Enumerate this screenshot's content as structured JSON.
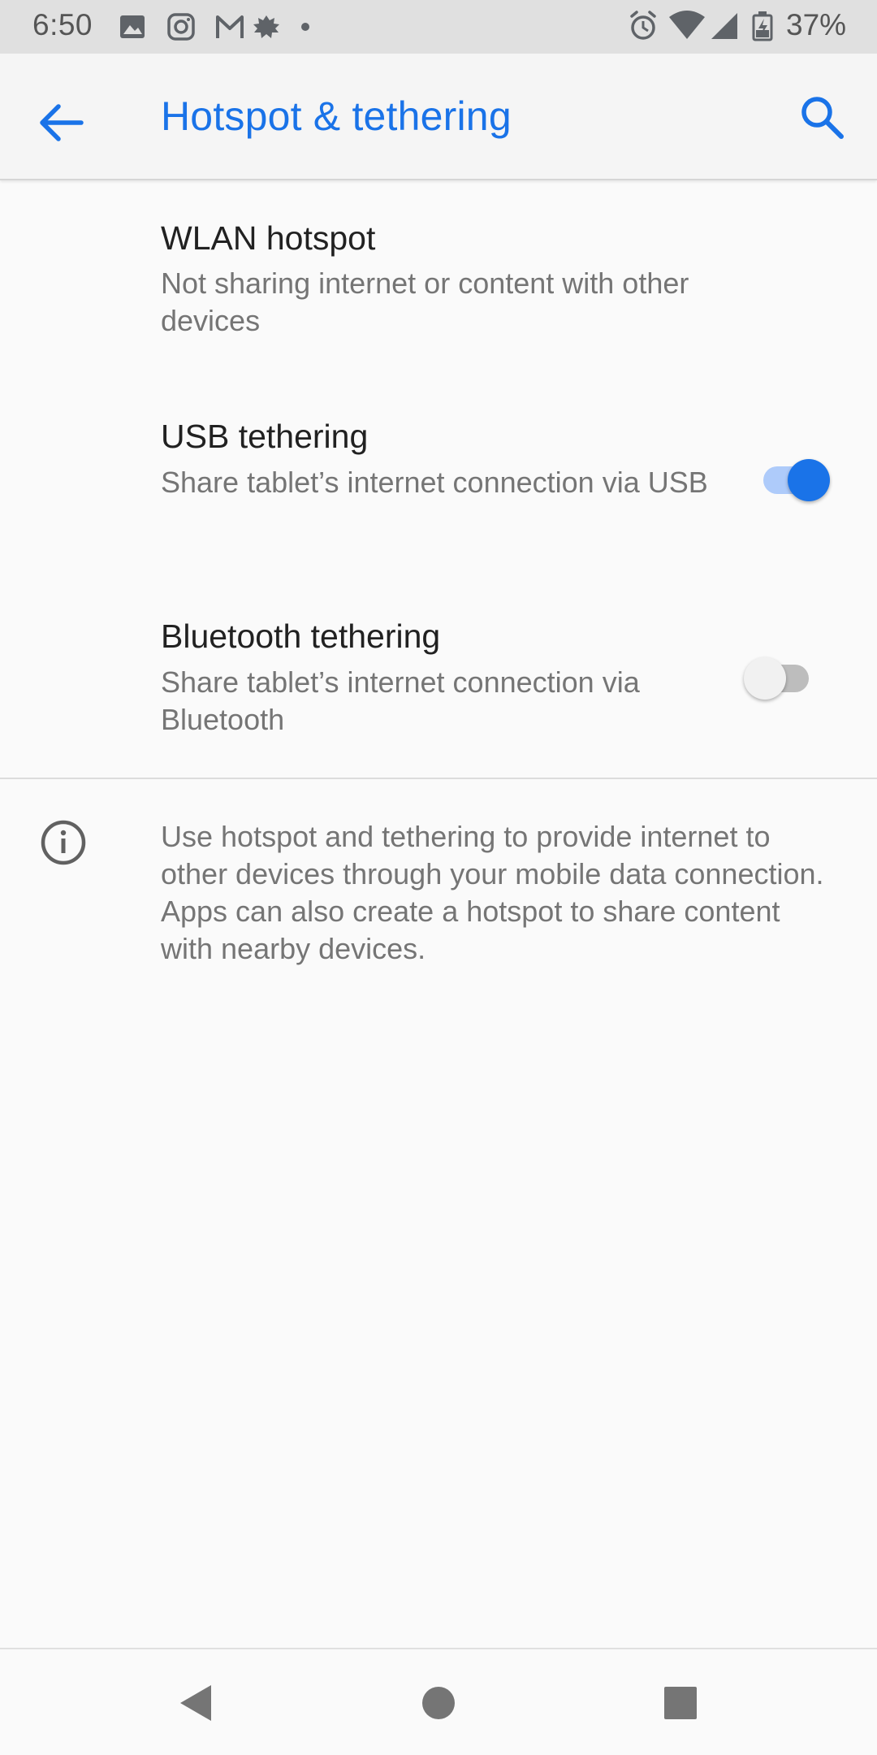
{
  "status_bar": {
    "time": "6:50",
    "battery_text": "37%",
    "left_icons": [
      "image-icon",
      "instagram-icon",
      "gmail-icon",
      "leaf-icon",
      "dot-icon"
    ],
    "right_icons": [
      "alarm-icon",
      "wifi-icon",
      "signal-icon",
      "battery-icon"
    ]
  },
  "toolbar": {
    "title": "Hotspot & tethering",
    "back_icon": "arrow-back-icon",
    "search_icon": "search-icon"
  },
  "preferences": [
    {
      "title": "WLAN hotspot",
      "summary": "Not sharing internet or content with other devices",
      "has_toggle": false
    },
    {
      "title": "USB tethering",
      "summary": "Share tablet’s internet connection via USB",
      "has_toggle": true,
      "enabled": true
    },
    {
      "title": "Bluetooth tethering",
      "summary": "Share tablet’s internet connection via Bluetooth",
      "has_toggle": true,
      "enabled": false
    }
  ],
  "info": {
    "icon": "info-icon",
    "text": "Use hotspot and tethering to provide internet to other devices through your mobile data connection. Apps can also create a hotspot to share content with nearby devices."
  },
  "nav_bar": {
    "buttons": [
      "back-triangle-icon",
      "home-circle-icon",
      "recents-square-icon"
    ]
  },
  "colors": {
    "accent": "#1a73e8",
    "toggle_on_track": "#aecbfa",
    "toggle_off_track": "#bdbdbd",
    "toggle_off_thumb": "#f1f1f1"
  }
}
